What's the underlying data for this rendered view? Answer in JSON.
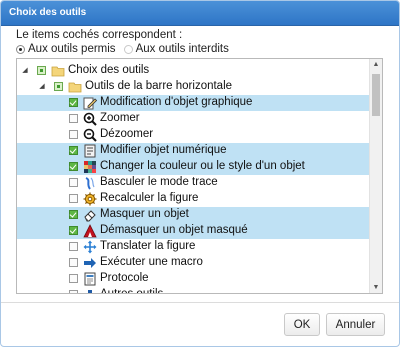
{
  "dialog": {
    "title": "Choix des outils"
  },
  "prompt": "Le items cochés correspondent :",
  "radios": [
    {
      "label": "Aux outils permis",
      "checked": true
    },
    {
      "label": "Aux outils interdits",
      "checked": false
    }
  ],
  "tree": {
    "rows": [
      {
        "label": "Choix des outils",
        "level": 0,
        "expander": "expanded",
        "check": "partial",
        "icon": "folder-icon",
        "selected": false
      },
      {
        "label": "Outils de la barre horizontale",
        "level": 1,
        "expander": "expanded",
        "check": "partial",
        "icon": "folder-icon",
        "selected": false
      },
      {
        "label": "Modification d'objet graphique",
        "level": 2,
        "check": "checked",
        "icon": "edit-object-icon",
        "selected": true
      },
      {
        "label": "Zoomer",
        "level": 2,
        "check": "unchecked",
        "icon": "zoom-in-icon",
        "selected": false
      },
      {
        "label": "Dézoomer",
        "level": 2,
        "check": "unchecked",
        "icon": "zoom-out-icon",
        "selected": false
      },
      {
        "label": "Modifier objet numérique",
        "level": 2,
        "check": "checked",
        "icon": "numeric-edit-icon",
        "selected": true
      },
      {
        "label": "Changer la couleur ou le style d'un objet",
        "level": 2,
        "check": "checked",
        "icon": "color-grid-icon",
        "selected": true
      },
      {
        "label": "Basculer le mode trace",
        "level": 2,
        "check": "unchecked",
        "icon": "trace-icon",
        "selected": false
      },
      {
        "label": "Recalculer la figure",
        "level": 2,
        "check": "unchecked",
        "icon": "gear-icon",
        "selected": false
      },
      {
        "label": "Masquer un objet",
        "level": 2,
        "check": "checked",
        "icon": "eraser-icon",
        "selected": true
      },
      {
        "label": "Démasquer un objet masqué",
        "level": 2,
        "check": "checked",
        "icon": "unmask-icon",
        "selected": true
      },
      {
        "label": "Translater la figure",
        "level": 2,
        "check": "unchecked",
        "icon": "move-icon",
        "selected": false
      },
      {
        "label": "Exécuter une macro",
        "level": 2,
        "check": "unchecked",
        "icon": "arrow-right-icon",
        "selected": false
      },
      {
        "label": "Protocole",
        "level": 2,
        "check": "unchecked",
        "icon": "document-icon",
        "selected": false
      },
      {
        "label": "Autres outils",
        "level": 2,
        "check": "unchecked",
        "icon": "plus-icon",
        "selected": false
      }
    ]
  },
  "buttons": {
    "ok": "OK",
    "cancel": "Annuler"
  },
  "colors": {
    "titlebar": "#2e75c6",
    "selection": "#bfe1f4",
    "check": "#5db644"
  }
}
